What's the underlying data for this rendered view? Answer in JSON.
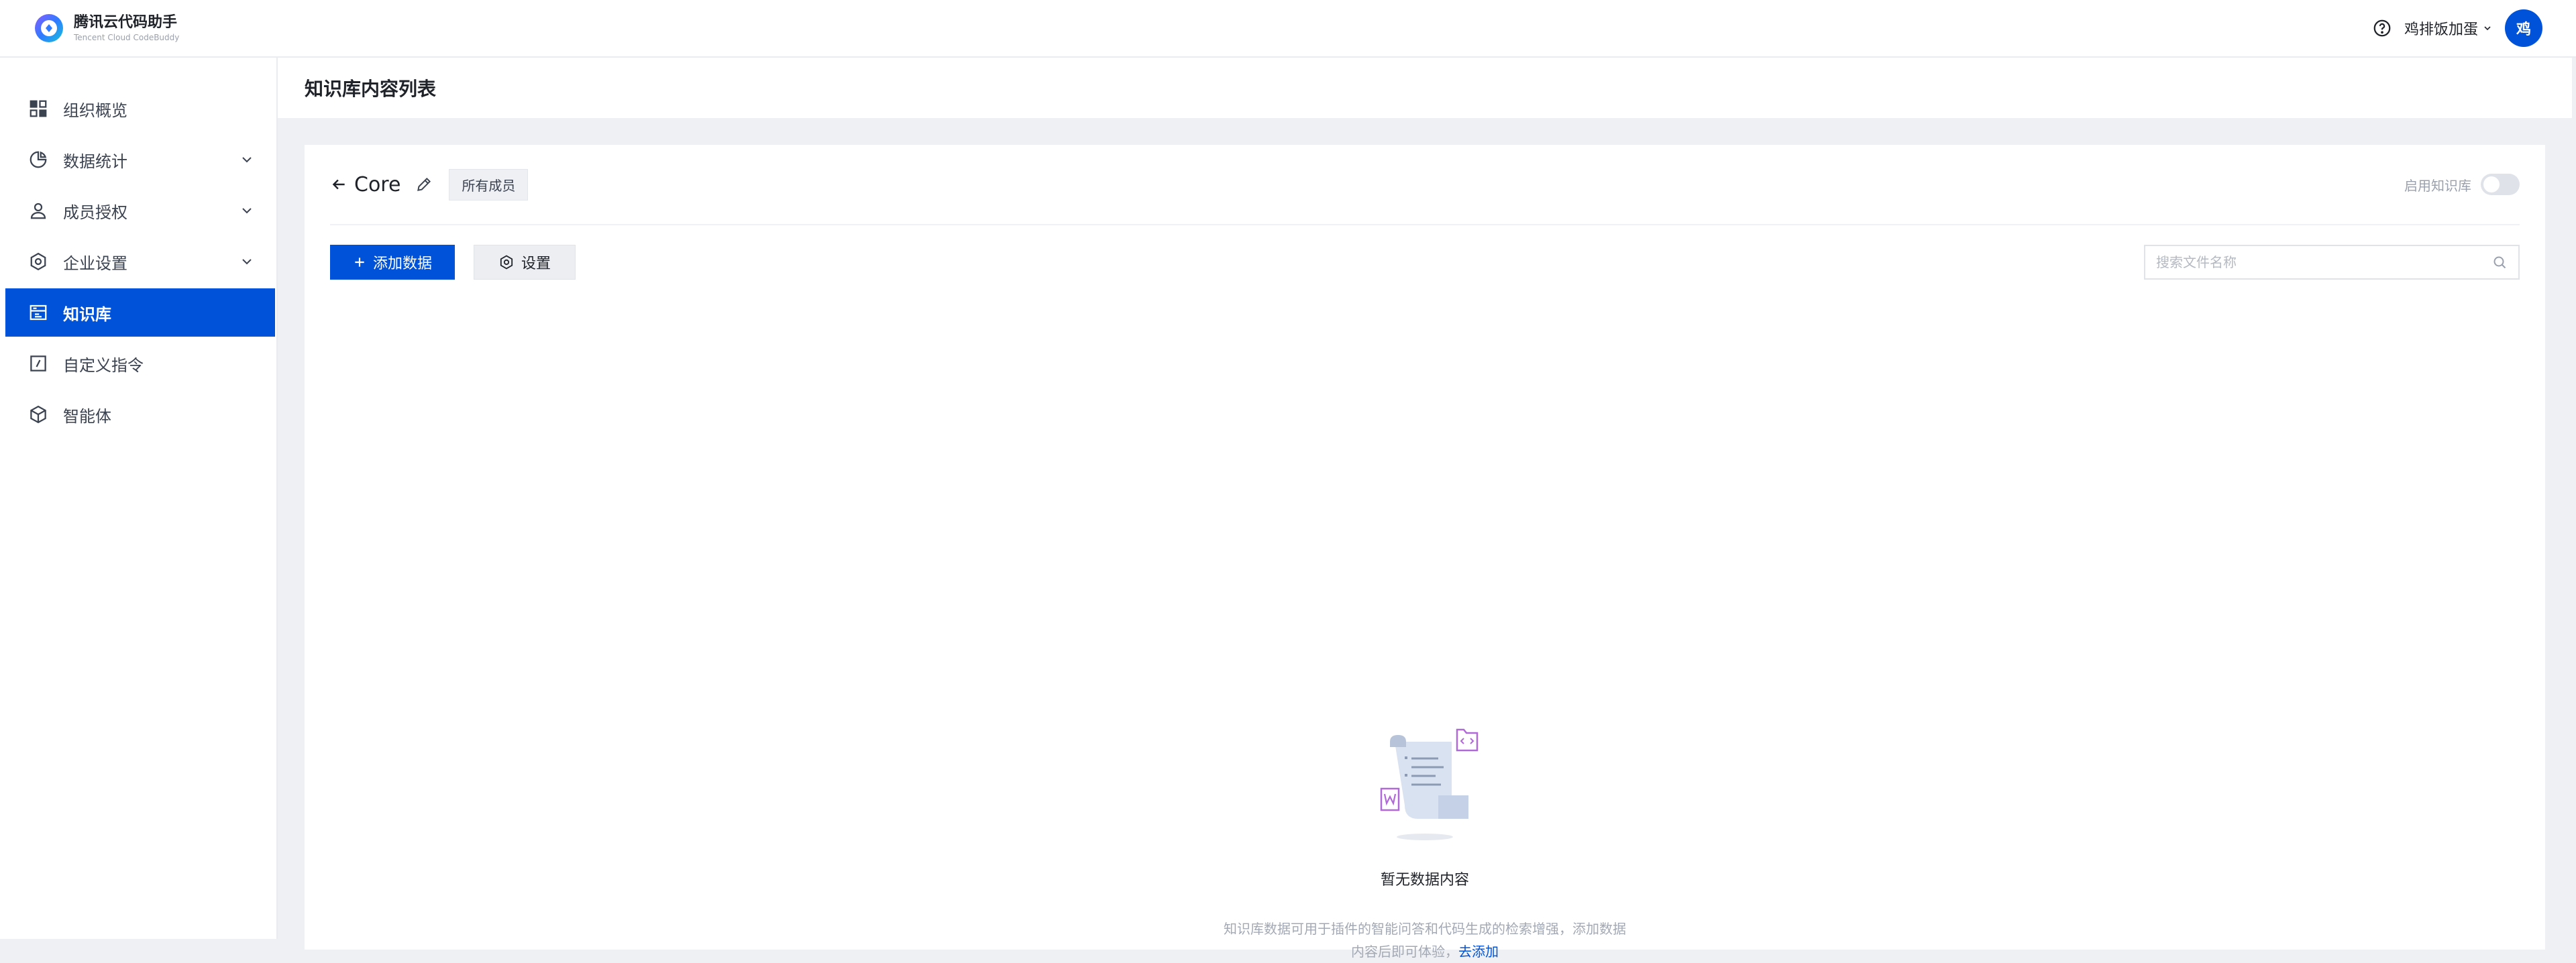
{
  "app": {
    "title": "腾讯云代码助手",
    "subtitle": "Tencent Cloud CodeBuddy",
    "brand_color": "#0052d9"
  },
  "topbar": {
    "help_icon": "help-circle-icon",
    "user_name": "鸡排饭加蛋",
    "avatar_text": "鸡"
  },
  "sidebar": {
    "items": [
      {
        "label": "组织概览",
        "icon": "grid-icon"
      },
      {
        "label": "数据统计",
        "icon": "pie-chart-icon",
        "expandable": true
      },
      {
        "label": "成员授权",
        "icon": "user-icon",
        "expandable": true
      },
      {
        "label": "企业设置",
        "icon": "settings-icon",
        "expandable": true
      },
      {
        "label": "知识库",
        "icon": "knowledge-base-icon",
        "active": true
      },
      {
        "label": "自定义指令",
        "icon": "slash-command-icon"
      },
      {
        "label": "智能体",
        "icon": "cube-icon"
      }
    ]
  },
  "page": {
    "title": "知识库内容列表"
  },
  "kb": {
    "name": "Core",
    "scope_tag": "所有成员",
    "toggle_label": "启用知识库",
    "toggle_on": false
  },
  "toolbar": {
    "add_label": "添加数据",
    "settings_label": "设置",
    "search_placeholder": "搜索文件名称"
  },
  "empty": {
    "title": "暂无数据内容",
    "desc_line1": "知识库数据可用于插件的智能问答和代码生成的检索增强，添加数据",
    "desc_line2_prefix": "内容后即可体验，",
    "link": "去添加"
  }
}
